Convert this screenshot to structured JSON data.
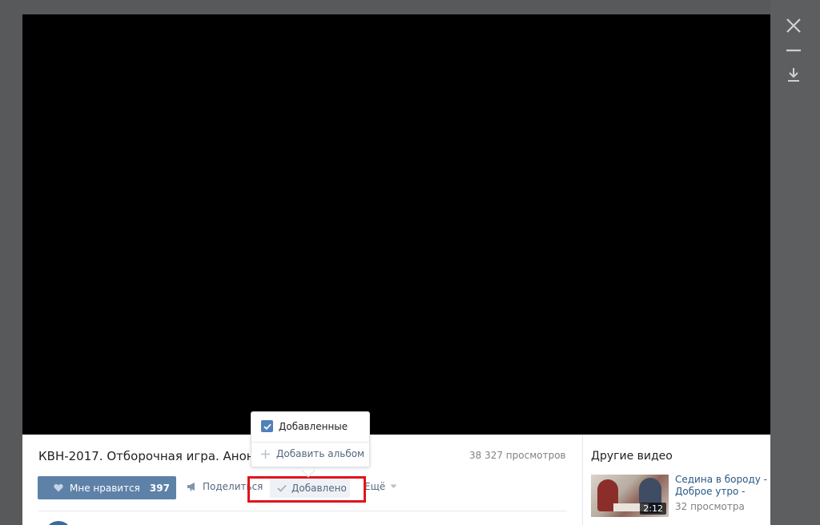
{
  "video": {
    "title": "КВН-2017. Отборочная игра. Анонс",
    "views": "38 327 просмотров"
  },
  "actions": {
    "like_label": "Мне нравится",
    "like_count": "397",
    "share_label": "Поделиться",
    "added_label": "Добавлено",
    "more_label": "Ещё"
  },
  "popup": {
    "added_item_label": "Добавленные",
    "add_album_label": "Добавить альбом"
  },
  "sidebar": {
    "title": "Другие видео",
    "items": [
      {
        "title": "Седина в бороду - Доброе утро -",
        "views": "32 просмотра",
        "duration": "2:12"
      }
    ]
  },
  "colors": {
    "accent": "#5e81a8",
    "link": "#2a5885",
    "highlight": "#e0141b"
  }
}
